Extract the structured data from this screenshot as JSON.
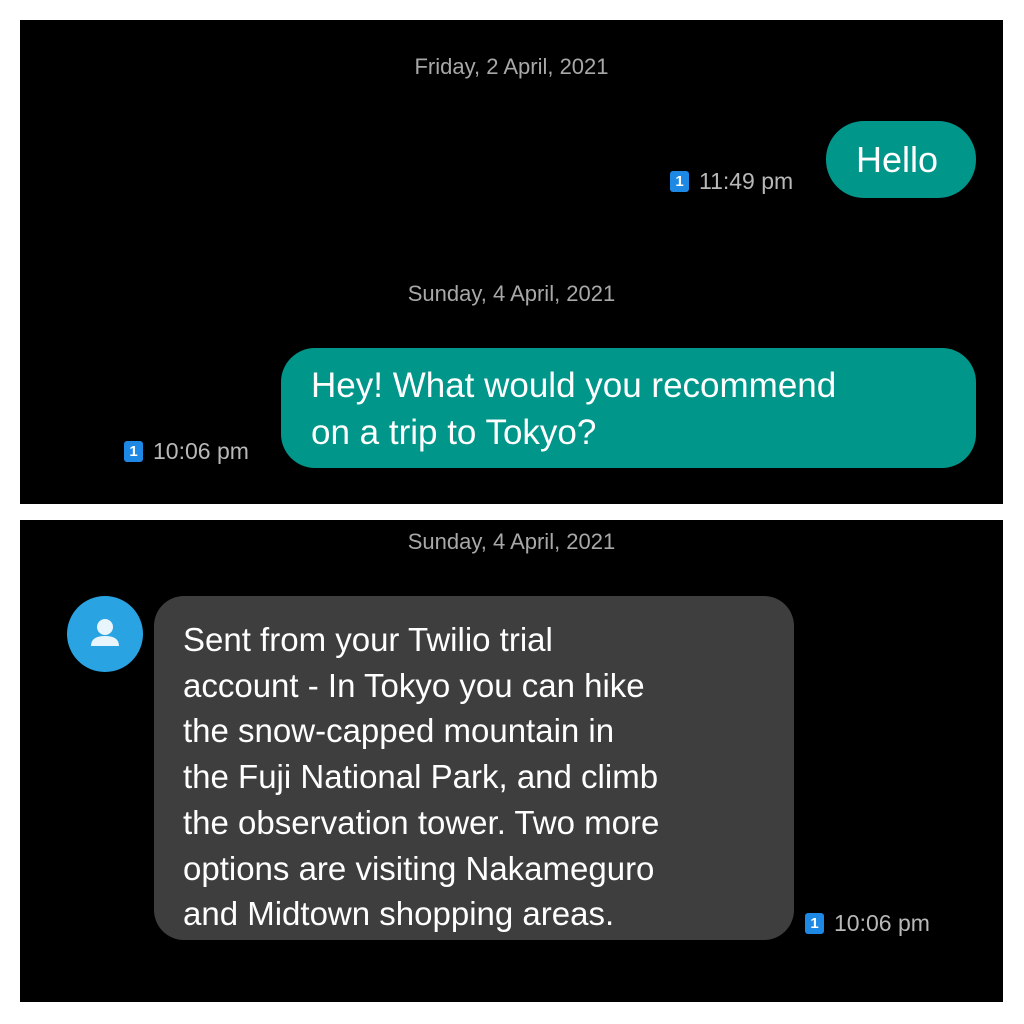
{
  "top_panel": {
    "date_1": "Friday, 2 April, 2021",
    "msg_1": {
      "text": "Hello",
      "sim": "1",
      "time": "11:49 pm"
    },
    "date_2": "Sunday, 4 April, 2021",
    "msg_2": {
      "line_1": "Hey! What would you recommend",
      "line_2": "on a trip to Tokyo?",
      "sim": "1",
      "time": "10:06 pm"
    }
  },
  "bottom_panel": {
    "date": "Sunday, 4 April, 2021",
    "contact": {
      "avatar_icon": "person-icon"
    },
    "reply": {
      "lines": [
        "Sent from your Twilio trial",
        "account - In Tokyo you can hike",
        "the snow-capped mountain in",
        "the Fuji National Park, and climb",
        "the observation tower. Two more",
        "options are visiting Nakameguro",
        "and Midtown shopping areas."
      ],
      "sim": "1",
      "time": "10:06 pm"
    }
  },
  "colors": {
    "sent_bubble": "#00968a",
    "received_bubble": "#3e3e3e",
    "avatar": "#29a3e2",
    "sim_badge": "#1e88e5",
    "background": "#000000"
  }
}
